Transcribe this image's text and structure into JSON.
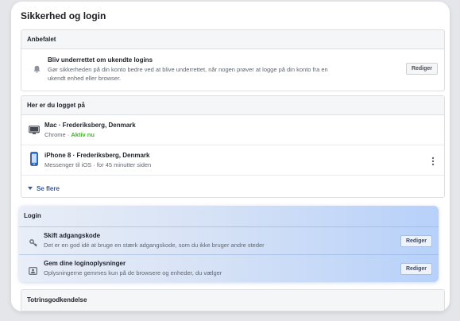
{
  "page": {
    "title": "Sikkerhed og login"
  },
  "recommended": {
    "header": "Anbefalet",
    "title": "Bliv underrettet om ukendte logins",
    "desc_line1": "Gør sikkerheden på din konto bedre ved at blive underrettet, når nogen prøver at logge på din konto fra en",
    "desc_line2": "ukendt enhed eller browser.",
    "button": "Rediger"
  },
  "logged_in": {
    "header": "Her er du logget på",
    "sessions": [
      {
        "device": "Mac · Frederiksberg, Denmark",
        "browser": "Chrome",
        "separator": " · ",
        "status": "Aktiv nu"
      },
      {
        "device": "iPhone 8 · Frederiksberg, Denmark",
        "detail": "Messenger til iOS · for 45 minutter siden"
      }
    ],
    "see_more": "Se flere"
  },
  "login": {
    "header": "Login",
    "items": [
      {
        "title": "Skift adgangskode",
        "desc": "Det er en god idé at bruge en stærk adgangskode, som du ikke bruger andre steder",
        "button": "Rediger"
      },
      {
        "title": "Gem dine loginoplysninger",
        "desc": "Oplysningerne gemmes kun på de browsere og enheder, du vælger",
        "button": "Rediger"
      }
    ]
  },
  "two_factor": {
    "header": "Totrinsgodkendelse"
  },
  "icons": {
    "bell": "bell-icon",
    "monitor": "monitor-icon",
    "phone": "phone-icon",
    "more": "more-options-icon",
    "caret": "caret-down-icon",
    "key": "key-icon",
    "id_card": "id-card-icon"
  },
  "colors": {
    "active": "#42b72a",
    "link": "#385898",
    "highlight": "#b7d1fa"
  }
}
